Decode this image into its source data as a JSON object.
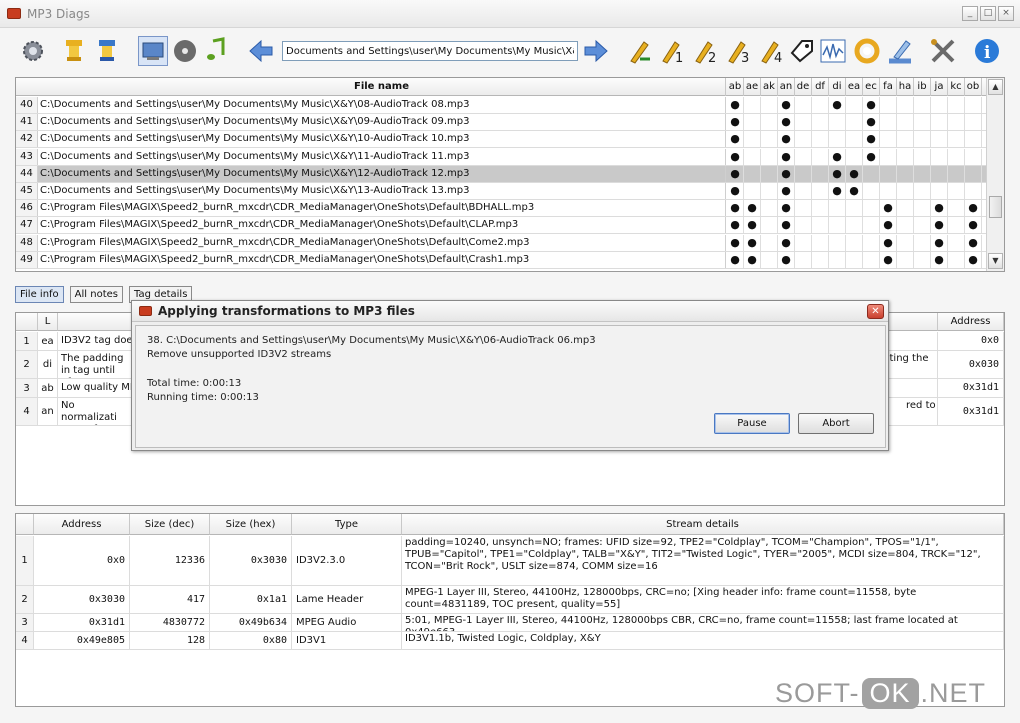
{
  "window": {
    "title": "MP3 Diags"
  },
  "toolbar": {
    "path": "Documents and Settings\\user\\My Documents\\My Music\\X&Y",
    "icons": [
      "gear-icon",
      "filter-icon",
      "filter-remove-icon",
      "folder-view-icon",
      "album-icon",
      "note-icon",
      "back-icon",
      "path-input",
      "forward-icon",
      "transform-icon",
      "transform-1-icon",
      "transform-2-icon",
      "transform-3-icon",
      "transform-4-icon",
      "tag-icon",
      "normalize-icon",
      "rescan-icon",
      "edit-icon",
      "tools-icon",
      "info-icon"
    ]
  },
  "file_grid": {
    "header_label": "File name",
    "columns": [
      "ab",
      "ae",
      "ak",
      "an",
      "de",
      "df",
      "di",
      "ea",
      "ec",
      "fa",
      "ha",
      "ib",
      "ja",
      "kc",
      "ob"
    ],
    "rows": [
      {
        "num": "40",
        "path": "C:\\Documents and Settings\\user\\My Documents\\My Music\\X&Y\\08-AudioTrack 08.mp3",
        "dots": [
          "ab",
          "an",
          "di",
          "ec"
        ],
        "selected": false
      },
      {
        "num": "41",
        "path": "C:\\Documents and Settings\\user\\My Documents\\My Music\\X&Y\\09-AudioTrack 09.mp3",
        "dots": [
          "ab",
          "an",
          "ec"
        ],
        "selected": false
      },
      {
        "num": "42",
        "path": "C:\\Documents and Settings\\user\\My Documents\\My Music\\X&Y\\10-AudioTrack 10.mp3",
        "dots": [
          "ab",
          "an",
          "ec"
        ],
        "selected": false
      },
      {
        "num": "43",
        "path": "C:\\Documents and Settings\\user\\My Documents\\My Music\\X&Y\\11-AudioTrack 11.mp3",
        "dots": [
          "ab",
          "an",
          "di",
          "ec"
        ],
        "selected": false
      },
      {
        "num": "44",
        "path": "C:\\Documents and Settings\\user\\My Documents\\My Music\\X&Y\\12-AudioTrack 12.mp3",
        "dots": [
          "ab",
          "an",
          "di",
          "ea"
        ],
        "selected": true
      },
      {
        "num": "45",
        "path": "C:\\Documents and Settings\\user\\My Documents\\My Music\\X&Y\\13-AudioTrack 13.mp3",
        "dots": [
          "ab",
          "an",
          "di",
          "ea"
        ],
        "selected": false
      },
      {
        "num": "46",
        "path": "C:\\Program Files\\MAGIX\\Speed2_burnR_mxcdr\\CDR_MediaManager\\OneShots\\Default\\BDHALL.mp3",
        "dots": [
          "ab",
          "ae",
          "an",
          "fa",
          "ja",
          "ob"
        ],
        "selected": false
      },
      {
        "num": "47",
        "path": "C:\\Program Files\\MAGIX\\Speed2_burnR_mxcdr\\CDR_MediaManager\\OneShots\\Default\\CLAP.mp3",
        "dots": [
          "ab",
          "ae",
          "an",
          "fa",
          "ja",
          "ob"
        ],
        "selected": false
      },
      {
        "num": "48",
        "path": "C:\\Program Files\\MAGIX\\Speed2_burnR_mxcdr\\CDR_MediaManager\\OneShots\\Default\\Come2.mp3",
        "dots": [
          "ab",
          "ae",
          "an",
          "fa",
          "ja",
          "ob"
        ],
        "selected": false
      },
      {
        "num": "49",
        "path": "C:\\Program Files\\MAGIX\\Speed2_burnR_mxcdr\\CDR_MediaManager\\OneShots\\Default\\Crash1.mp3",
        "dots": [
          "ab",
          "ae",
          "an",
          "fa",
          "ja",
          "ob"
        ],
        "selected": false
      }
    ],
    "dot": "●"
  },
  "tabs": [
    "File info",
    "All notes",
    "Tag details"
  ],
  "notes_grid": {
    "headers": {
      "num": "",
      "code": "L",
      "address": "Address"
    },
    "rows": [
      {
        "num": "1",
        "code": "ea",
        "text": "ID3V2 tag doe",
        "text_right": "",
        "address": "0x0"
      },
      {
        "num": "2",
        "code": "di",
        "text": "The padding in tag until after",
        "text_right": "cting the",
        "address": "0x030"
      },
      {
        "num": "3",
        "code": "ab",
        "text": "Low quality MF",
        "text_right": "",
        "address": "0x31d1"
      },
      {
        "num": "4",
        "code": "an",
        "text": "No normalizati songs from oth",
        "text_right": "red to",
        "address": "0x31d1"
      }
    ]
  },
  "streams_grid": {
    "headers": {
      "num": "",
      "address": "Address",
      "size_dec": "Size (dec)",
      "size_hex": "Size (hex)",
      "type": "Type",
      "details": "Stream details"
    },
    "rows": [
      {
        "num": "1",
        "address": "0x0",
        "size_dec": "12336",
        "size_hex": "0x3030",
        "type": "ID3V2.3.0",
        "details": "padding=10240, unsynch=NO; frames: UFID size=92, TPE2=\"Coldplay\", TCOM=\"Champion\", TPOS=\"1/1\", TPUB=\"Capitol\", TPE1=\"Coldplay\", TALB=\"X&Y\", TIT2=\"Twisted Logic\", TYER=\"2005\", MCDI size=804, TRCK=\"12\", TCON=\"Brit Rock\", USLT size=874, COMM size=16"
      },
      {
        "num": "2",
        "address": "0x3030",
        "size_dec": "417",
        "size_hex": "0x1a1",
        "type": "Lame Header",
        "details": "MPEG-1 Layer III, Stereo, 44100Hz, 128000bps, CRC=no; [Xing header info: frame count=11558, byte count=4831189, TOC present, quality=55]"
      },
      {
        "num": "3",
        "address": "0x31d1",
        "size_dec": "4830772",
        "size_hex": "0x49b634",
        "type": "MPEG Audio",
        "details": "5:01, MPEG-1 Layer III, Stereo, 44100Hz, 128000bps CBR, CRC=no, frame count=11558; last frame located at 0x49e663"
      },
      {
        "num": "4",
        "address": "0x49e805",
        "size_dec": "128",
        "size_hex": "0x80",
        "type": "ID3V1",
        "details": "ID3V1.1b, Twisted Logic, Coldplay, X&Y"
      }
    ]
  },
  "dialog": {
    "title": "Applying transformations to MP3 files",
    "line1": "38. C:\\Documents and Settings\\user\\My Documents\\My Music\\X&Y\\06-AudioTrack 06.mp3",
    "line2": "Remove unsupported ID3V2 streams",
    "total_time": "Total time: 0:00:13",
    "running_time": "Running time: 0:00:13",
    "pause_label": "Pause",
    "abort_label": "Abort"
  },
  "watermark": {
    "prefix": "SOFT-",
    "ok": "OK",
    "suffix": ".NET"
  }
}
